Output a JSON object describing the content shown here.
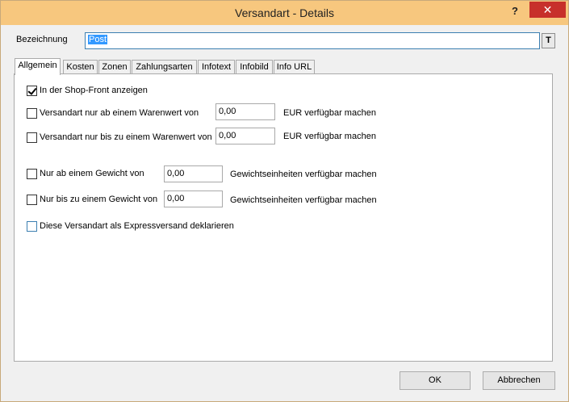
{
  "window": {
    "title": "Versandart - Details",
    "help_label": "?",
    "close_label": "✕"
  },
  "name_label": "Bezeichnung",
  "name_value": "Post",
  "t_button_label": "T",
  "tabs": [
    {
      "label": "Allgemein",
      "active": true
    },
    {
      "label": "Kosten",
      "active": false
    },
    {
      "label": "Zonen",
      "active": false
    },
    {
      "label": "Zahlungsarten",
      "active": false
    },
    {
      "label": "Infotext",
      "active": false
    },
    {
      "label": "Infobild",
      "active": false
    },
    {
      "label": "Info URL",
      "active": false
    }
  ],
  "options": {
    "show_in_shop": {
      "label": "In der Shop-Front anzeigen",
      "checked": true
    },
    "min_value": {
      "label": "Versandart nur ab einem Warenwert von",
      "checked": false,
      "value": "0,00",
      "suffix": "EUR verfügbar machen"
    },
    "max_value": {
      "label": "Versandart nur bis zu einem Warenwert von",
      "checked": false,
      "value": "0,00",
      "suffix": "EUR verfügbar machen"
    },
    "min_weight": {
      "label": "Nur ab einem Gewicht von",
      "checked": false,
      "value": "0,00",
      "suffix": "Gewichtseinheiten verfügbar machen"
    },
    "max_weight": {
      "label": "Nur bis zu einem Gewicht von",
      "checked": false,
      "value": "0,00",
      "suffix": "Gewichtseinheiten verfügbar machen"
    },
    "express": {
      "label": "Diese Versandart als Expressversand deklarieren",
      "checked": false
    }
  },
  "buttons": {
    "ok": "OK",
    "cancel": "Abbrechen"
  },
  "colors": {
    "titlebar": "#f7c77e",
    "close": "#c7302b",
    "selection": "#3399ff"
  }
}
